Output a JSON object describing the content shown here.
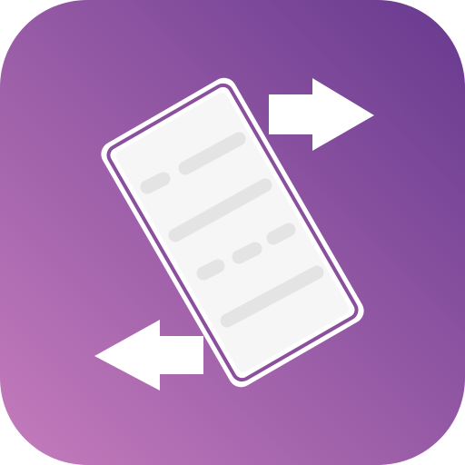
{
  "icon": {
    "name": "phone-transfer-app-icon",
    "shape": "rounded-square",
    "colors": {
      "gradient_start": "#c57cbc",
      "gradient_end": "#67398f",
      "foreground": "#ffffff",
      "screen": "#f6f6f6",
      "text_lines": "#e4e4e4"
    },
    "glyphs": {
      "device": "phone-icon",
      "top_arrow": "arrow-right-icon",
      "bottom_arrow": "arrow-left-icon",
      "content": "text-lines"
    }
  }
}
